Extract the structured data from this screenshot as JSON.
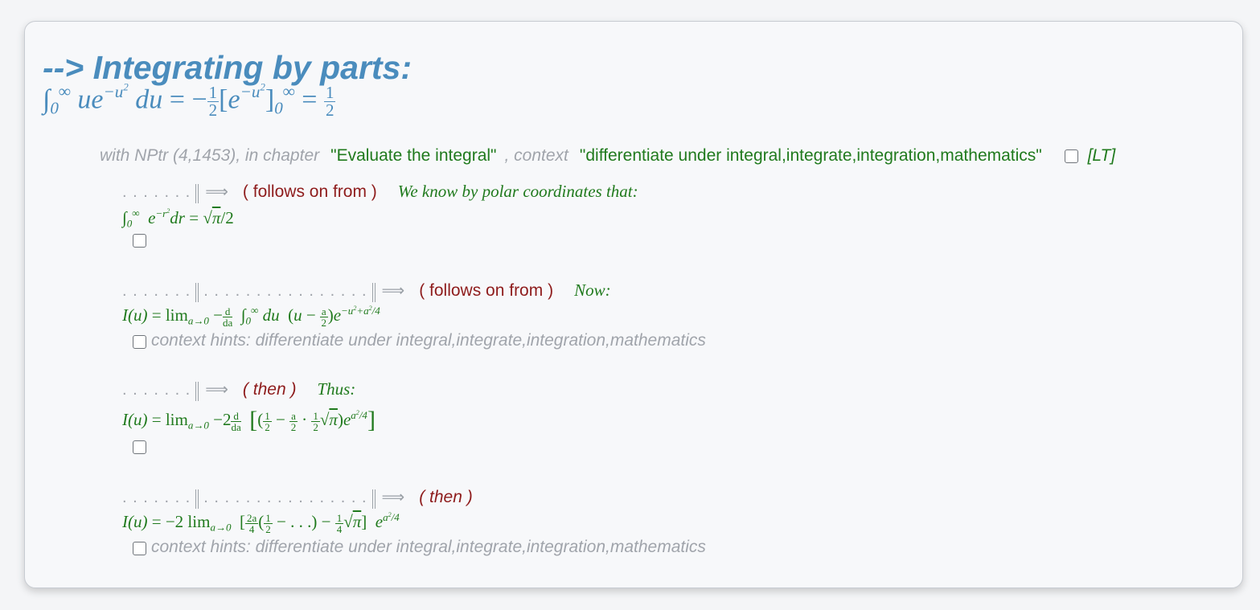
{
  "header": {
    "title": "--> Integrating by parts:"
  },
  "meta": {
    "prefix": "with NPtr (4,1453), in chapter",
    "chapter": "\"Evaluate the integral\"",
    "context_label": ", context",
    "context": "\"differentiate under integral,integrate,integration,mathematics\"",
    "lt_label": "[LT]"
  },
  "steps": [
    {
      "leader": ". . . . . . .",
      "rule": "( follows on from )",
      "note": "We know by polar coordinates that:",
      "hint": ""
    },
    {
      "leader": ". . . . . . .",
      "leader2": ". . . . . . . . . . . . . . . .",
      "rule": "( follows on from )",
      "note": "Now:",
      "hint": "context hints: differentiate under integral,integrate,integration,mathematics"
    },
    {
      "leader": ". . . . . . .",
      "rule": "( then )",
      "note": "Thus:",
      "hint": ""
    },
    {
      "leader": ". . . . . . .",
      "leader2": ". . . . . . . . . . . . . . . .",
      "rule": "( then )",
      "note": "",
      "hint": "context hints: differentiate under integral,integrate,integration,mathematics"
    }
  ],
  "colors": {
    "title": "#4a8cbd",
    "green": "#207a1d",
    "red": "#8e1c1c",
    "muted": "#a0a4ab"
  }
}
